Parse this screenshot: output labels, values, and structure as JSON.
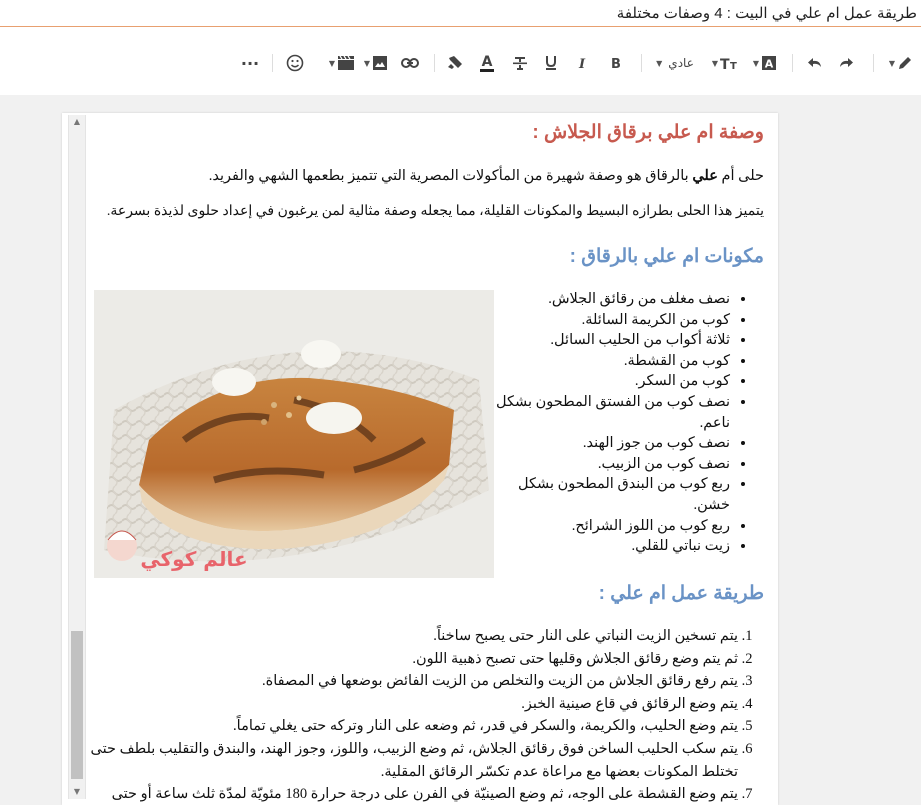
{
  "window": {
    "title": "طريقة عمل ام علي في البيت : 4 وصفات مختلفة"
  },
  "toolbar": {
    "paragraph_style": "عادي",
    "more_label": "···"
  },
  "icons": [
    "pencil-icon",
    "undo-icon",
    "redo-icon",
    "text-highlight-icon",
    "text-size-icon",
    "bold-icon",
    "italic-icon",
    "underline-icon",
    "strikethrough-icon",
    "text-color-icon",
    "highlight-pen-icon",
    "link-icon",
    "image-icon",
    "video-icon",
    "emoji-icon",
    "more-icon"
  ],
  "colors": {
    "heading_red": "#c75a4f",
    "heading_blue": "#6a93c6",
    "title_underline": "#e8a070"
  },
  "article": {
    "heading1": "وصفة ام علي برقاق الجلاش :",
    "intro_prefix": "حلى أم ",
    "intro_bold": "علي",
    "intro_rest": " بالرقاق هو وصفة شهيرة من المأكولات المصرية التي تتميز بطعمها الشهي والفريد.",
    "intro2": "يتميز هذا الحلى بطرازه البسيط والمكونات القليلة، مما يجعله وصفة مثالية لمن يرغبون في إعداد حلوى لذيذة بسرعة.",
    "heading2": "مكونات ام علي بالرقاق :",
    "ingredients": [
      "نصف مغلف من رقائق الجلاش.",
      "كوب من الكريمة السائلة.",
      "ثلاثة أكواب من الحليب السائل.",
      "كوب من القشطة.",
      "كوب من السكر.",
      "نصف كوب من الفستق المطحون بشكل ناعم.",
      "نصف كوب من جوز الهند.",
      "نصف كوب من الزبيب.",
      "ربع كوب من البندق المطحون بشكل خشن.",
      "ربع كوب من اللوز الشرائح.",
      "زيت نباتي للقلي."
    ],
    "image_watermark": "عالم كوكي",
    "heading3": "طريقة عمل ام علي :",
    "steps": [
      "يتم تسخين الزيت النباتي على النار حتى يصبح ساخناً.",
      "ثم يتم وضع رقائق الجلاش وقليها حتى تصبح ذهبية اللون.",
      "يتم رفع رقائق الجلاش من الزيت والتخلص من الزيت الفائض بوضعها في المصفاة.",
      "يتم وضع الرقائق في قاع صينية الخبز.",
      "يتم وضع الحليب، والكريمة، والسكر في قدر، ثم وضعه على النار وتركه حتى يغلي تماماً.",
      "يتم سكب الحليب الساخن فوق رقائق الجلاش، ثم وضع الزبيب، واللوز، وجوز الهند، والبندق والتقليب بلطف حتى تختلط المكونات بعضها مع مراعاة عدم تكسّر الرقائق المقلية.",
      "يتم وضع القشطة على الوجه، ثم وضع الصينيّة في الفرن على درجة حرارة 180 مئويّة لمدّة ثلث ساعة أو حتى"
    ]
  }
}
